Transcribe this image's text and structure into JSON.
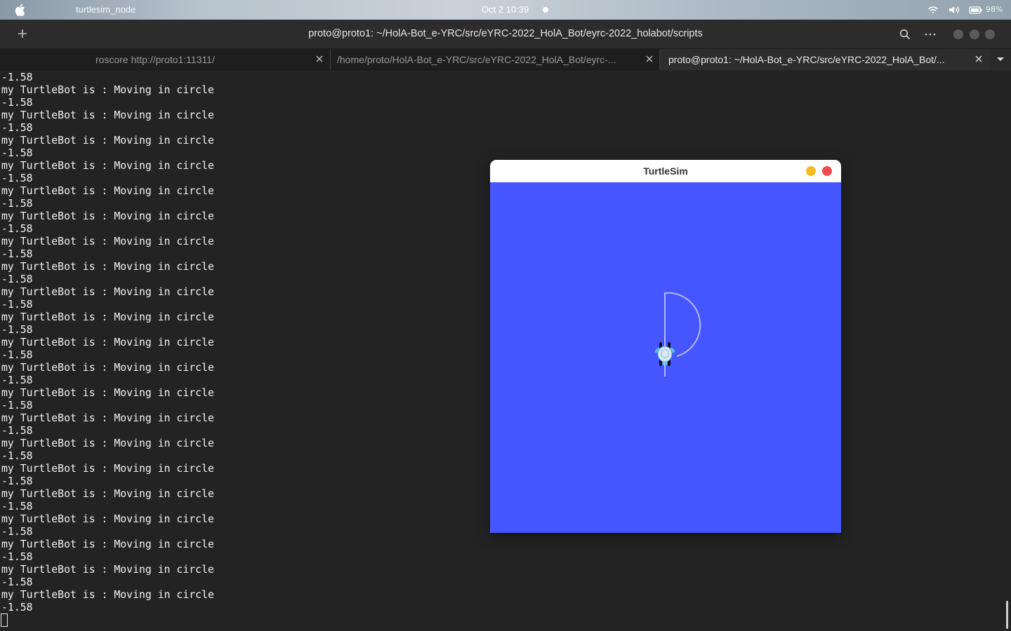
{
  "topbar": {
    "app_name": "turtlesim_node",
    "clock": "Oct 2  10:39",
    "battery_text": "98%",
    "icons": [
      "apple-icon",
      "wifi-icon",
      "volume-icon",
      "battery-icon"
    ]
  },
  "terminal": {
    "window_title": "proto@proto1: ~/HolA-Bot_e-YRC/src/eYRC-2022_HolA_Bot/eyrc-2022_holabot/scripts",
    "tabs": [
      {
        "label": "roscore http://proto1:11311/"
      },
      {
        "label": "/home/proto/HolA-Bot_e-YRC/src/eYRC-2022_HolA_Bot/eyrc-..."
      },
      {
        "label": "proto@proto1: ~/HolA-Bot_e-YRC/src/eYRC-2022_HolA_Bot/..."
      }
    ],
    "lines": [
      "-1.58",
      "my TurtleBot is : Moving in circle",
      "-1.58",
      "my TurtleBot is : Moving in circle",
      "-1.58",
      "my TurtleBot is : Moving in circle",
      "-1.58",
      "my TurtleBot is : Moving in circle",
      "-1.58",
      "my TurtleBot is : Moving in circle",
      "-1.58",
      "my TurtleBot is : Moving in circle",
      "-1.58",
      "my TurtleBot is : Moving in circle",
      "-1.58",
      "my TurtleBot is : Moving in circle",
      "-1.58",
      "my TurtleBot is : Moving in circle",
      "-1.58",
      "my TurtleBot is : Moving in circle",
      "-1.58",
      "my TurtleBot is : Moving in circle",
      "-1.58",
      "my TurtleBot is : Moving in circle",
      "-1.58",
      "my TurtleBot is : Moving in circle",
      "-1.58",
      "my TurtleBot is : Moving in circle",
      "-1.58",
      "my TurtleBot is : Moving in circle",
      "-1.58",
      "my TurtleBot is : Moving in circle",
      "-1.58",
      "my TurtleBot is : Moving in circle",
      "-1.58",
      "my TurtleBot is : Moving in circle",
      "-1.58",
      "my TurtleBot is : Moving in circle",
      "-1.58",
      "my TurtleBot is : Moving in circle",
      "-1.58",
      "my TurtleBot is : Moving in circle",
      "-1.58"
    ]
  },
  "turtlesim": {
    "title": "TurtleSim",
    "background_color": "#4556ff",
    "path_color": "#b3b8ff"
  },
  "colors": {
    "terminal_bg": "#232323",
    "terminal_text": "#f2f2f2",
    "minimize": "#f5bd22",
    "close": "#f14c4c"
  }
}
